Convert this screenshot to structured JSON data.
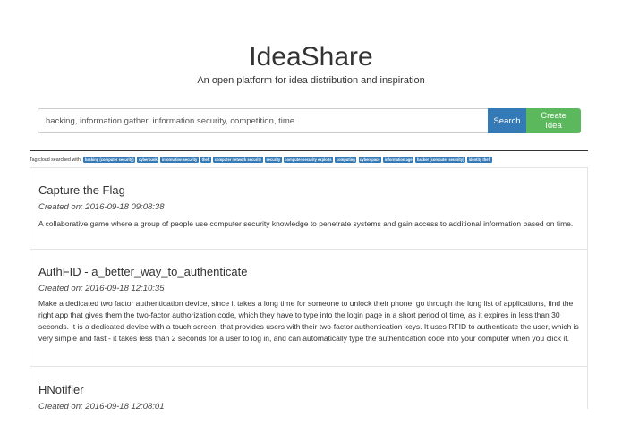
{
  "header": {
    "title": "IdeaShare",
    "tagline": "An open platform for idea distribution and inspiration"
  },
  "search": {
    "value": "hacking, information gather, information security, competition, time",
    "search_label": "Search",
    "create_label": "Create Idea"
  },
  "tag_cloud": {
    "label": "Tag cloud searched with:",
    "tags": [
      "hacking (computer security)",
      "cyberpunk",
      "information security",
      "theft",
      "computer network security",
      "security",
      "computer security exploits",
      "computing",
      "cyberspace",
      "information age",
      "hacker (computer security)",
      "identity theft"
    ]
  },
  "ideas": [
    {
      "title": "Capture the Flag",
      "date": "Created on: 2016-09-18 09:08:38",
      "description": "A collaborative game where a group of people use computer security knowledge to penetrate systems and gain access to additional information based on time."
    },
    {
      "title": "AuthFID - a_better_way_to_authenticate",
      "date": "Created on: 2016-09-18 12:10:35",
      "description": "Make a dedicated two factor authentication device, since it takes a long time for someone to unlock their phone, go through the long list of applications, find the right app that gives them the two-factor authorization code, which they have to type into the login page in a short period of time, as it expires in less than 30 seconds. It is a dedicated device with a touch screen, that provides users with their two-factor authentication keys. It uses RFID to authenticate the user, which is very simple and fast - it takes less than 2 seconds for a user to log in, and can automatically type the authentication code into your computer when you click it."
    },
    {
      "title": "HNotifier",
      "date": "Created on: 2016-09-18 12:08:01",
      "description": ""
    }
  ],
  "colors": {
    "search_button": "#337ab7",
    "create_button": "#5cb85c",
    "tag_background": "#337ab7"
  }
}
